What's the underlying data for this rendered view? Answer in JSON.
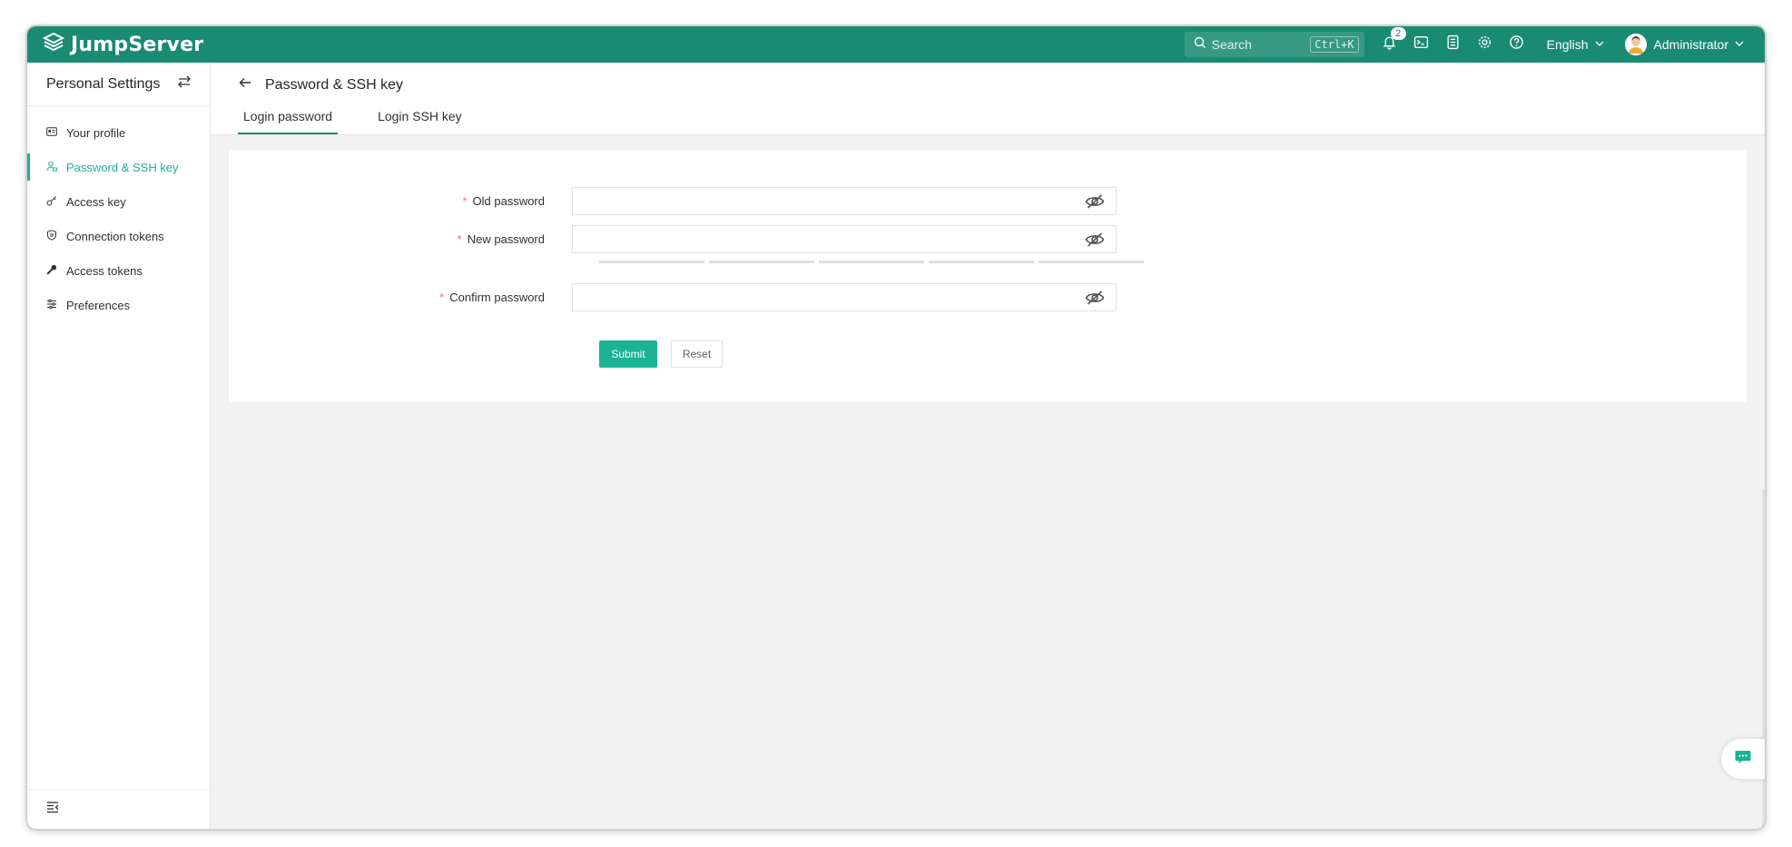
{
  "app": {
    "brand": "JumpServer"
  },
  "header": {
    "search_placeholder": "Search",
    "search_shortcut": "Ctrl+K",
    "notification_count": "2",
    "language": "English",
    "user_name": "Administrator"
  },
  "sidebar": {
    "title": "Personal Settings",
    "items": [
      {
        "label": "Your profile",
        "icon": "profile-card-icon"
      },
      {
        "label": "Password & SSH key",
        "icon": "user-lock-icon",
        "active": true
      },
      {
        "label": "Access key",
        "icon": "key-icon"
      },
      {
        "label": "Connection tokens",
        "icon": "shield-icon"
      },
      {
        "label": "Access tokens",
        "icon": "wrench-key-icon"
      },
      {
        "label": "Preferences",
        "icon": "sliders-icon"
      }
    ]
  },
  "page": {
    "title": "Password & SSH key",
    "tabs": [
      {
        "label": "Login password",
        "active": true
      },
      {
        "label": "Login SSH key",
        "active": false
      }
    ]
  },
  "form": {
    "old_password_label": "Old password",
    "new_password_label": "New password",
    "confirm_password_label": "Confirm password",
    "old_password_value": "",
    "new_password_value": "",
    "confirm_password_value": "",
    "submit_label": "Submit",
    "reset_label": "Reset"
  },
  "colors": {
    "header": "#1a8b73",
    "accent": "#1ab394",
    "required": "#f56c6c"
  }
}
